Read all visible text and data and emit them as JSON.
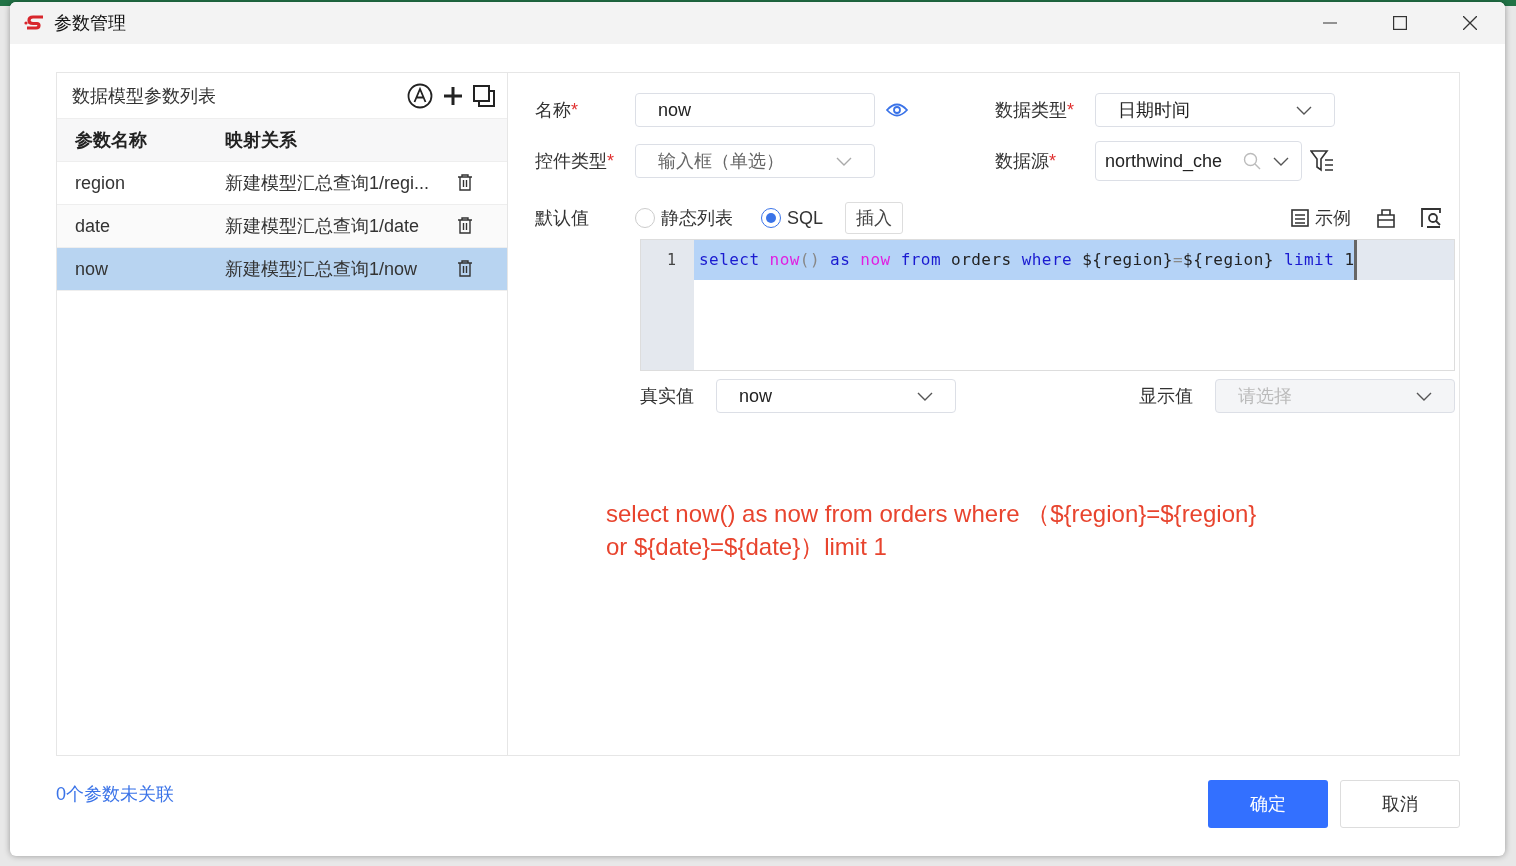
{
  "window": {
    "title": "参数管理"
  },
  "param_list": {
    "title": "数据模型参数列表",
    "columns": [
      "参数名称",
      "映射关系"
    ],
    "rows": [
      {
        "name": "region",
        "mapping": "新建模型汇总查询1/regi...",
        "selected": false
      },
      {
        "name": "date",
        "mapping": "新建模型汇总查询1/date",
        "selected": false
      },
      {
        "name": "now",
        "mapping": "新建模型汇总查询1/now",
        "selected": true
      }
    ]
  },
  "form": {
    "name_label": "名称",
    "name_value": "now",
    "data_type_label": "数据类型",
    "data_type_value": "日期时间",
    "control_type_label": "控件类型",
    "control_type_value": "输入框（单选）",
    "data_source_label": "数据源",
    "data_source_value": "northwind_che",
    "required_mark": "*",
    "default_label": "默认值",
    "radios": [
      {
        "label": "静态列表",
        "selected": false
      },
      {
        "label": "SQL",
        "selected": true
      }
    ],
    "insert_button": "插入",
    "example_button": "示例",
    "code": {
      "line_number": "1",
      "tokens": [
        {
          "text": "select ",
          "kind": "keyword"
        },
        {
          "text": "now",
          "kind": "func"
        },
        {
          "text": "() ",
          "kind": "op"
        },
        {
          "text": "as ",
          "kind": "keyword"
        },
        {
          "text": "now ",
          "kind": "func"
        },
        {
          "text": "from",
          "kind": "keyword"
        },
        {
          "text": " orders ",
          "kind": "plain"
        },
        {
          "text": "where",
          "kind": "keyword"
        },
        {
          "text": " ${region}",
          "kind": "plain"
        },
        {
          "text": "=",
          "kind": "op"
        },
        {
          "text": "${region} ",
          "kind": "plain"
        },
        {
          "text": "limit",
          "kind": "keyword"
        },
        {
          "text": " 1",
          "kind": "plain"
        }
      ]
    },
    "real_value_label": "真实值",
    "real_value": "now",
    "display_value_label": "显示值",
    "display_value_placeholder": "请选择"
  },
  "annotation": [
    "select now() as now from orders where （${region}=${region}",
    "or ${date}=${date}）limit 1"
  ],
  "footer": {
    "unlinked": "0个参数未关联",
    "ok": "确定",
    "cancel": "取消"
  }
}
